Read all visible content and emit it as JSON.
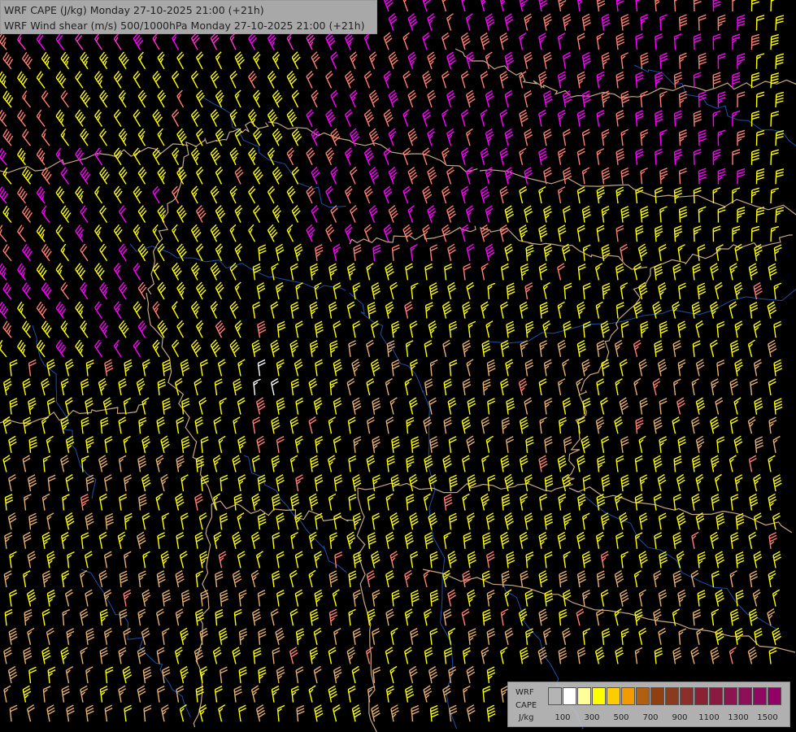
{
  "titles": {
    "line1": "WRF CAPE (J/kg) Monday 27-10-2025 21:00 (+21h)",
    "line2": "WRF Wind shear (m/s) 500/1000hPa Monday 27-10-2025 21:00 (+21h)"
  },
  "legend": {
    "model": "WRF",
    "parameter": "CAPE",
    "unit": "J/kg",
    "colors": [
      "#b4b4b4",
      "#ffffff",
      "#ffff99",
      "#ffff00",
      "#ffcc00",
      "#f29b00",
      "#b06010",
      "#904010",
      "#8c3a1e",
      "#8a2f2a",
      "#8a2235",
      "#8c1a40",
      "#8e1450",
      "#8e0e5a",
      "#90085f",
      "#920066"
    ],
    "tick_labels": [
      "100",
      "300",
      "500",
      "700",
      "900",
      "1100",
      "1300",
      "1500"
    ]
  },
  "layers": {
    "background": "#000000",
    "barb_colors": {
      "magenta": "#ff00ff",
      "pink": "#ff33cc",
      "salmon": "#ff8070",
      "yellow": "#ffff00",
      "tan": "#e6b070",
      "white": "#ffffff"
    },
    "border_color": "#e8c49a",
    "river_color": "#1e4fa8"
  }
}
